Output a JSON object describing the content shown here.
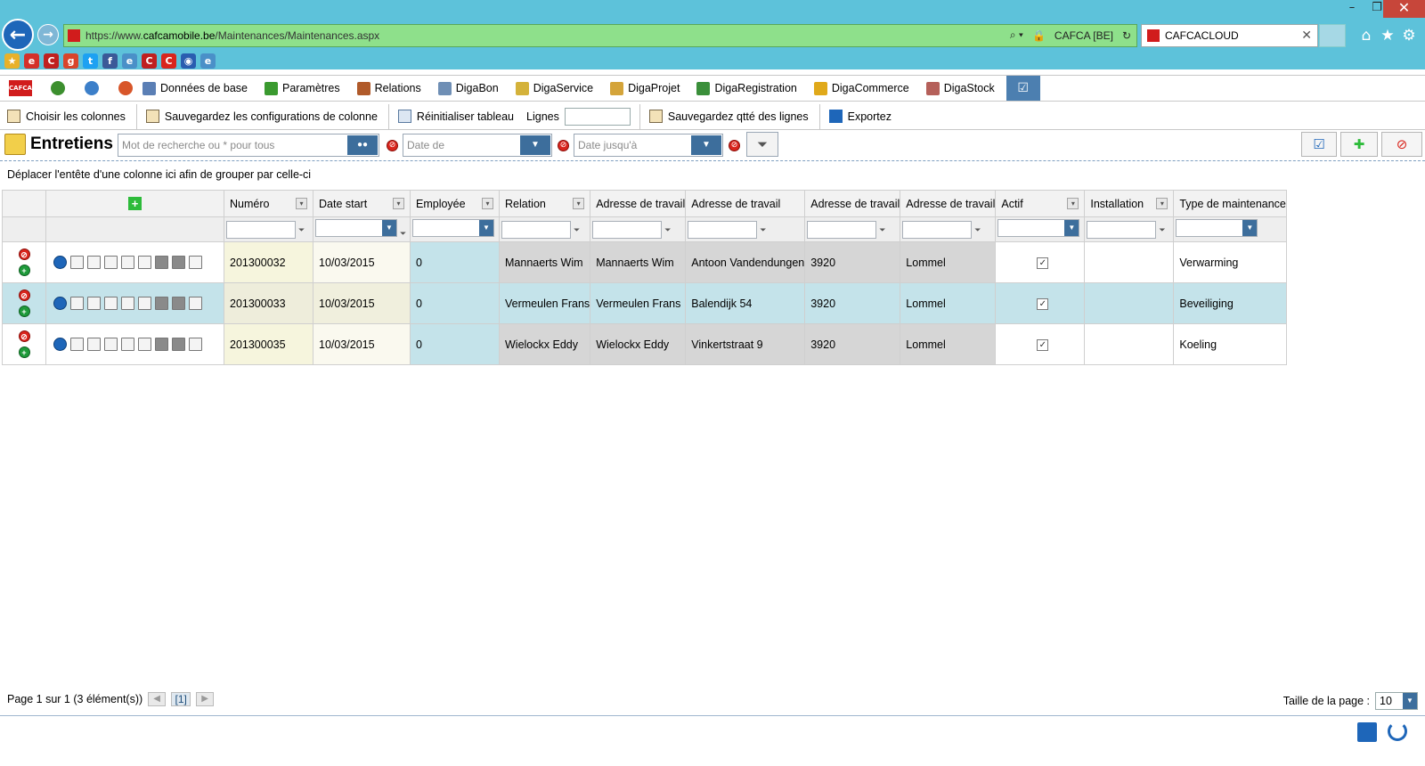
{
  "browser": {
    "url_prefix": "https://www.",
    "url_domain": "cafcamobile.be",
    "url_path": "/Maintenances/Maintenances.aspx",
    "site_identity": "CAFCA [BE]",
    "tab_title": "CAFCACLOUD",
    "window_controls": {
      "minimize": "–",
      "restore": "❐",
      "close": "✕"
    }
  },
  "menu": {
    "logo_text": "CAFCA",
    "items": [
      {
        "label": "Données de base",
        "color": "#5b7fb5"
      },
      {
        "label": "Paramètres",
        "color": "#3a9a2f"
      },
      {
        "label": "Relations",
        "color": "#b05a2a"
      },
      {
        "label": "DigaBon",
        "color": "#6f8fb5"
      },
      {
        "label": "DigaService",
        "color": "#d4b23a"
      },
      {
        "label": "DigaProjet",
        "color": "#d4a43a"
      },
      {
        "label": "DigaRegistration",
        "color": "#3a8f3a"
      },
      {
        "label": "DigaCommerce",
        "color": "#e0a91a"
      },
      {
        "label": "DigaStock",
        "color": "#b5605a"
      }
    ]
  },
  "toolbar": {
    "choose_columns": "Choisir les colonnes",
    "save_column_config": "Sauvegardez les configurations de colonne",
    "reset_table": "Réinitialiser tableau",
    "lines_label": "Lignes",
    "lines_value": "",
    "save_line_qty": "Sauvegardez qtté des lignes",
    "export": "Exportez"
  },
  "search": {
    "page_title": "Entretiens",
    "keyword_placeholder": "Mot de recherche ou * pour tous",
    "date_from_placeholder": "Date de",
    "date_to_placeholder": "Date jusqu'à"
  },
  "grid": {
    "group_panel_text": "Déplacer l'entête d'une colonne ici afin de grouper par celle-ci",
    "columns": [
      "Numéro",
      "Date start",
      "Employée",
      "Relation",
      "Adresse de travail",
      "Adresse de travail",
      "Adresse de travail",
      "Adresse de travail",
      "Actif",
      "Installation",
      "Type de maintenance"
    ],
    "rows": [
      {
        "numero": "201300032",
        "date_start": "10/03/2015",
        "employee": "0",
        "relation": "Mannaerts Wim",
        "addr1": "Mannaerts Wim",
        "addr2": "Antoon Vandendungen",
        "addr3": "3920",
        "addr4": "Lommel",
        "actif": "✓",
        "installation": "",
        "type": "Verwarming"
      },
      {
        "numero": "201300033",
        "date_start": "10/03/2015",
        "employee": "0",
        "relation": "Vermeulen Frans",
        "addr1": "Vermeulen Frans",
        "addr2": "Balendijk 54",
        "addr3": "3920",
        "addr4": "Lommel",
        "actif": "✓",
        "installation": "",
        "type": "Beveiliging"
      },
      {
        "numero": "201300035",
        "date_start": "10/03/2015",
        "employee": "0",
        "relation": "Wielockx Eddy",
        "addr1": "Wielockx Eddy",
        "addr2": "Vinkertstraat 9",
        "addr3": "3920",
        "addr4": "Lommel",
        "actif": "✓",
        "installation": "",
        "type": "Koeling"
      }
    ]
  },
  "pager": {
    "summary": "Page 1 sur 1 (3 élément(s))",
    "current_page": "[1]",
    "page_size_label": "Taille de la page :",
    "page_size_value": "10"
  }
}
